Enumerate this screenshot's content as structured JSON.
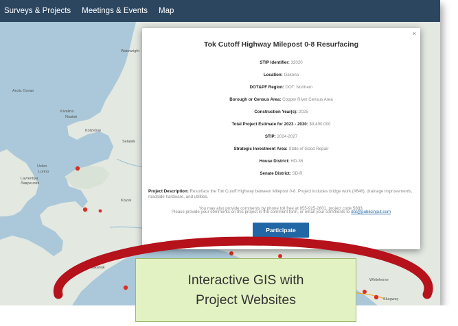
{
  "nav": {
    "items": [
      "Surveys & Projects",
      "Meetings & Events",
      "Map"
    ]
  },
  "map": {
    "labels": {
      "wainwright": "Wainwright",
      "kivalina": "Kivalina",
      "noatak": "Noatak",
      "kotzebue": "Kotzebue",
      "selawik": "Selawik",
      "uelen": "Uelen",
      "lorino": "Lorino",
      "lavrentiya": "Lavrentiya",
      "lavrentiya_ru": "Лаврентия",
      "koyuk": "Koyuk",
      "arctic_ocean": "Arctic Ocean",
      "whitehorse": "Whitehorse",
      "skagway": "Skagway",
      "alakanuk": "Alakanuk"
    },
    "colors": {
      "water": "#aac8d9",
      "land": "#e3e8e1",
      "marker": "#d93025",
      "road": "#f5a623"
    }
  },
  "popup": {
    "close": "×",
    "title": "Tok Cutoff Highway Milepost 0-8 Resurfacing",
    "fields": [
      {
        "label": "STIP Identifier:",
        "value": "32020"
      },
      {
        "label": "Location:",
        "value": "Gakona"
      },
      {
        "label": "DOT&PF Region:",
        "value": "DOT: Northern"
      },
      {
        "label": "Borough or Census Area:",
        "value": "Copper River Census Area"
      },
      {
        "label": "Construction Year(s):",
        "value": "2025"
      },
      {
        "label": "Total Project Estimate for 2023 - 2030:",
        "value": "$9,490,000"
      },
      {
        "label": "STIP:",
        "value": "2024-2027"
      },
      {
        "label": "Strategic Investment Area:",
        "value": "State of Good Repair"
      },
      {
        "label": "House District:",
        "value": "HD-36"
      },
      {
        "label": "Senate District:",
        "value": "SD-R"
      }
    ],
    "description_label": "Project Description:",
    "description": "Resurface the Tok Cutoff Highway between Milepost 0-8. Project includes bridge work (#646), drainage improvements, roadside hardware, and utilities.",
    "comment_text": "Please provide your comments on this project in the comment form, or email your comments to",
    "comment_email": "dot@publicinput.com",
    "phone_text": "You may also provide comments by phone toll free at 855-925-2801, project code 5883.",
    "participate_label": "Participate"
  },
  "callout": {
    "line1": "Interactive GIS with",
    "line2": "Project Websites"
  },
  "colors": {
    "navbar": "#2c4660",
    "button": "#2167a6",
    "callout_bg": "#e3f2c2",
    "ellipse": "#b5121b"
  }
}
